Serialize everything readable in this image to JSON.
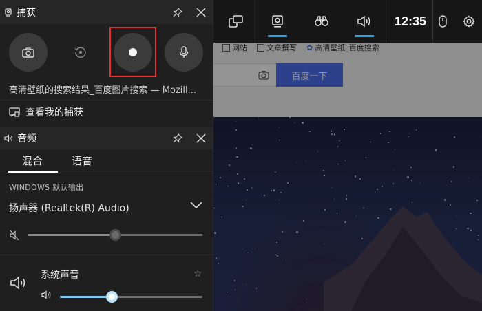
{
  "topbar": {
    "clock": "12:35",
    "items": [
      {
        "name": "widget-menu-icon"
      },
      {
        "name": "capture-icon",
        "active": true
      },
      {
        "name": "binoculars-icon"
      },
      {
        "name": "audio-icon",
        "active": true
      },
      {
        "name": "mouse-icon"
      },
      {
        "name": "settings-gear-icon"
      }
    ],
    "accent": "#2da3e8"
  },
  "capture": {
    "title": "捕获",
    "buttons": [
      {
        "name": "screenshot-camera-icon"
      },
      {
        "name": "record-last-icon"
      },
      {
        "name": "record-dot-icon",
        "highlighted": true
      },
      {
        "name": "microphone-icon"
      }
    ],
    "source": "高清壁纸的搜索结果_百度图片搜索 — Mozill...",
    "view_label": "查看我的捕获",
    "highlight_color": "#e53030"
  },
  "audio": {
    "title": "音频",
    "tabs": [
      "混合",
      "语音"
    ],
    "active_tab": 0,
    "output_label": "WINDOWS 默认输出",
    "device": "扬声器 (Realtek(R) Audio)",
    "master_volume": 0.5,
    "master_muted": true,
    "apps": [
      {
        "label": "系统声音",
        "volume": 0.36,
        "accent": "#7ec8f2"
      }
    ]
  },
  "background": {
    "bookmarks": [
      "网站",
      "文章撰写",
      "高清壁纸_百度搜索"
    ],
    "search_button": "百度一下"
  }
}
